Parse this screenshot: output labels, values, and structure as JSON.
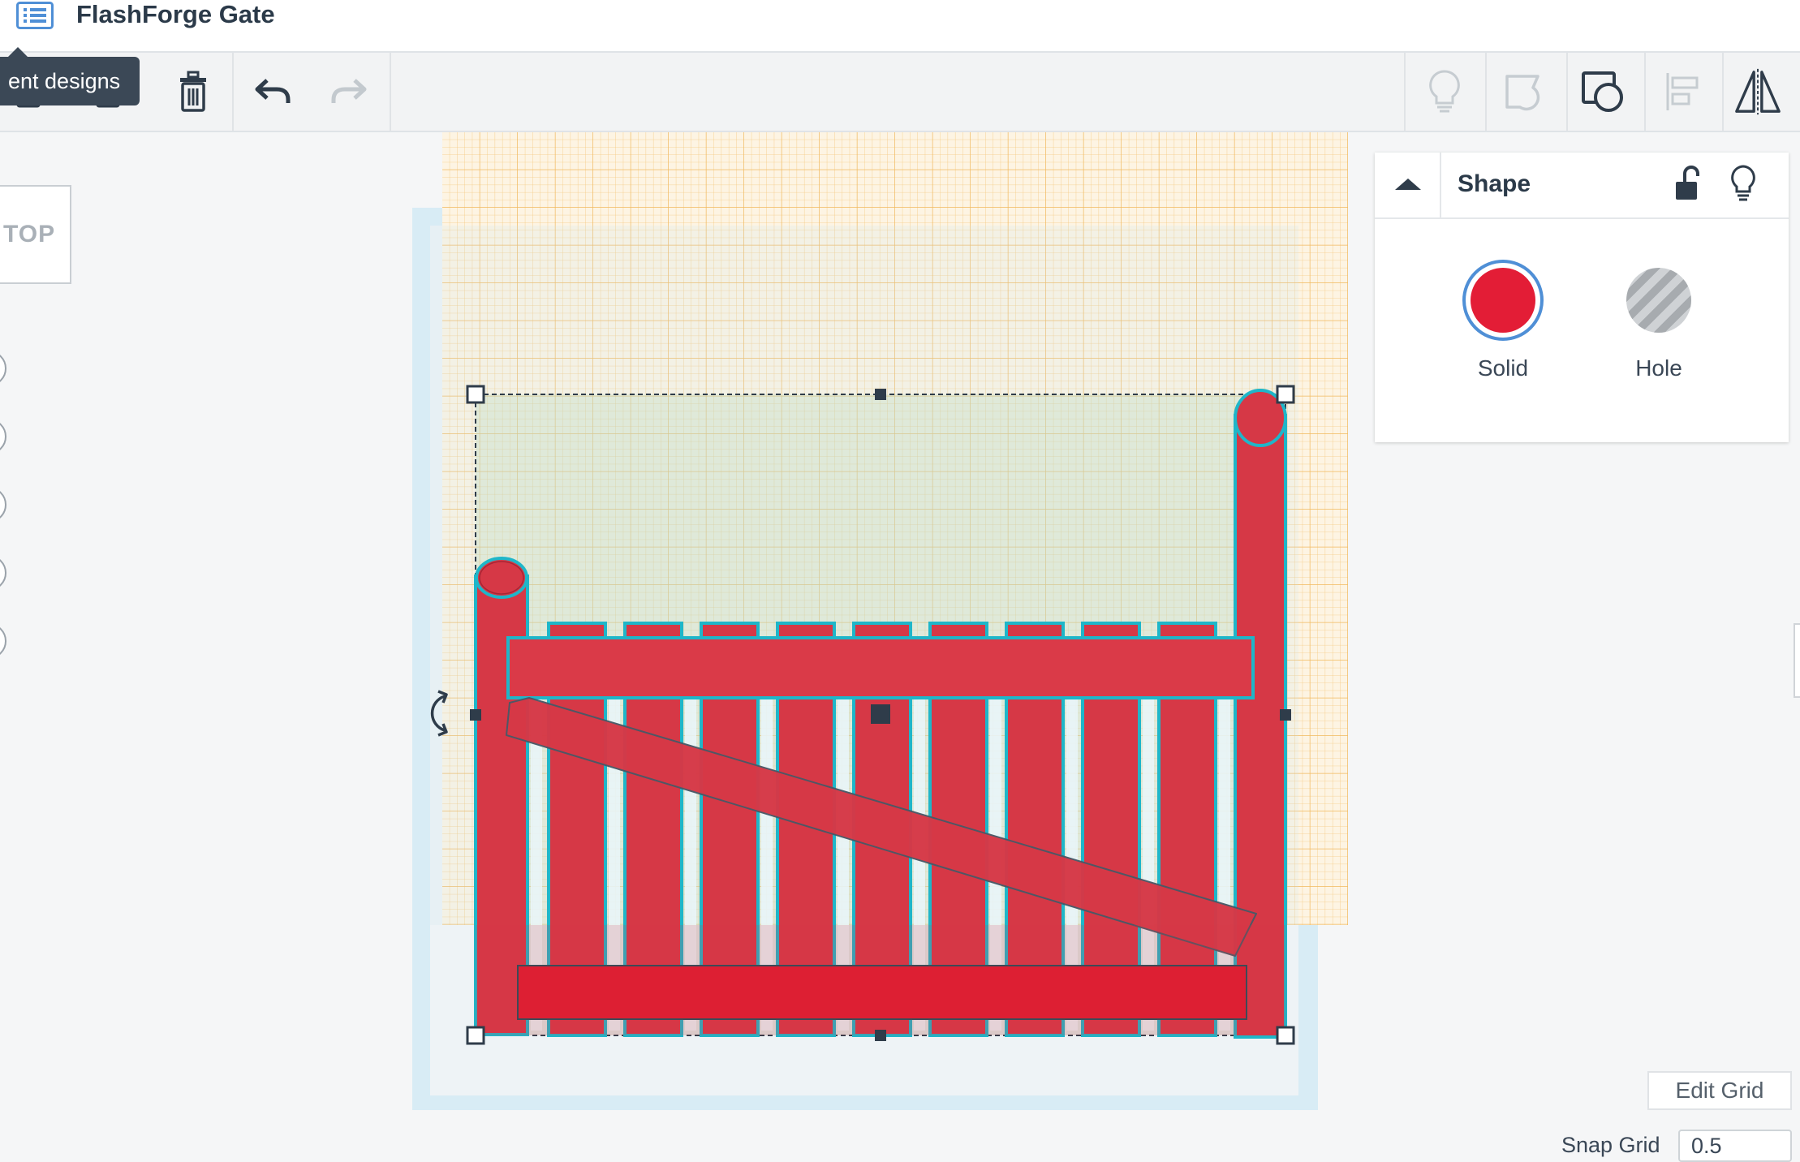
{
  "app": {
    "title": "FlashForge Gate",
    "menu_icon": "list-icon"
  },
  "toolbar": {
    "tooltip": "Recent designs",
    "tooltip_visible_text": "ent designs",
    "left_buttons": [
      "copy-icon",
      "duplicate-icon",
      "trash-icon",
      "undo-icon",
      "redo-icon"
    ],
    "right_buttons": [
      "lightbulb-icon",
      "note-icon",
      "ruler-icon",
      "align-icon",
      "mirror-icon"
    ]
  },
  "viewcube": {
    "face": "TOP"
  },
  "shape_panel": {
    "title": "Shape",
    "options": [
      {
        "label": "Solid",
        "color": "#e31d36",
        "selected": true
      },
      {
        "label": "Hole",
        "color": "#b8bbbe",
        "selected": false
      }
    ]
  },
  "grid": {
    "edit_label": "Edit Grid",
    "snap_label": "Snap Grid",
    "snap_value": "0.5"
  },
  "colors": {
    "accent": "#4f8fd6",
    "shape_red": "#d63846",
    "selection_outline": "#1fb6c9",
    "workplane_grid": "#f5c46a",
    "workplane_bg": "#dff0f7"
  }
}
